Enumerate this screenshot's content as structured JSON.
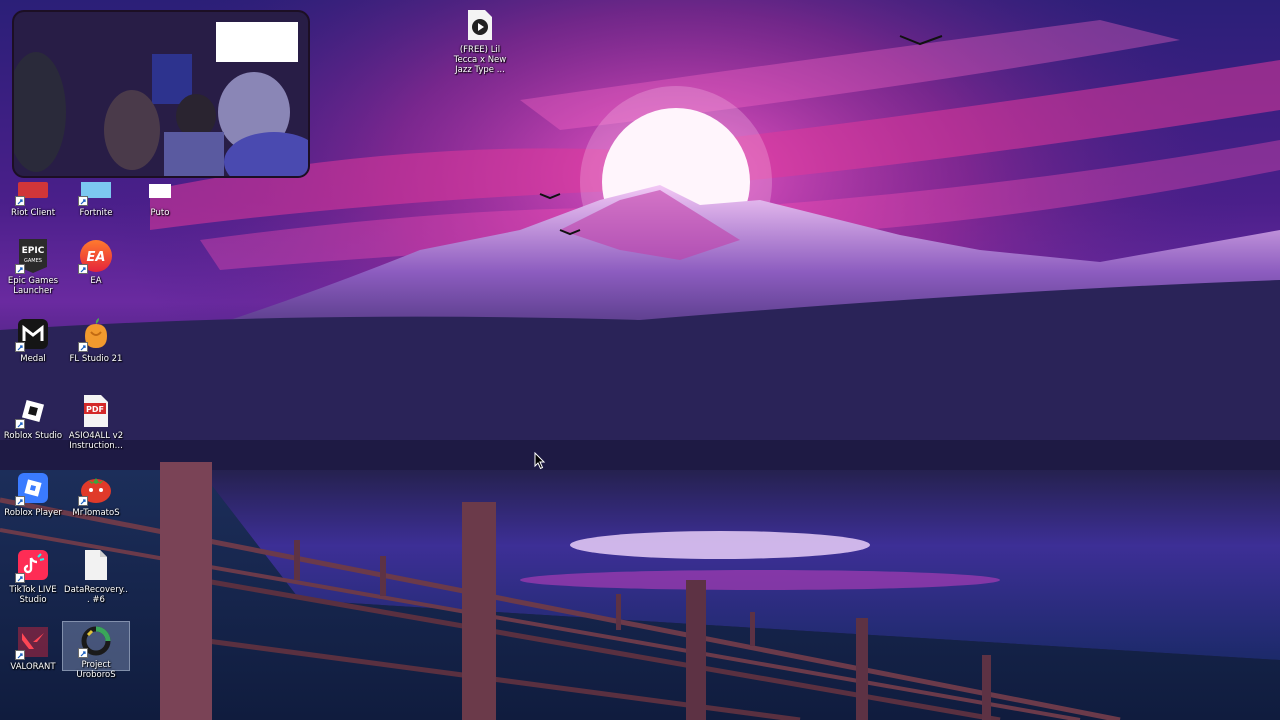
{
  "desktop": {
    "wallpaper": "synthwave-mountain-lake-sunset",
    "colors": {
      "sky_top": "#2a1a6e",
      "sky_magenta": "#e0389a",
      "sun": "#ffffff",
      "lake": "#3b2d8f",
      "fence": "#6b3a4a"
    }
  },
  "webcam_overlay": {
    "description_icon": "webcam-overlay"
  },
  "icons": [
    {
      "id": "riot-client",
      "label": "Riot Client",
      "icon": "riot-client-icon",
      "color": "#d13639"
    },
    {
      "id": "fortnite",
      "label": "Fortnite",
      "icon": "fortnite-icon",
      "color": "#7cc8f0"
    },
    {
      "id": "puto",
      "label": "Puto",
      "icon": "file-icon",
      "color": "#ffffff"
    },
    {
      "id": "epic-games",
      "label": "Epic Games Launcher",
      "icon": "epic-games-icon",
      "color": "#2a2a2a"
    },
    {
      "id": "ea",
      "label": "EA",
      "icon": "ea-icon",
      "color": "#ff4747"
    },
    {
      "id": "medal",
      "label": "Medal",
      "icon": "medal-icon",
      "color": "#1a1a1a"
    },
    {
      "id": "fl-studio",
      "label": "FL Studio 21",
      "icon": "fl-studio-icon",
      "color": "#f29a2e"
    },
    {
      "id": "roblox-studio",
      "label": "Roblox Studio",
      "icon": "roblox-studio-icon",
      "color": "#ffffff"
    },
    {
      "id": "asio4all",
      "label": "ASIO4ALL v2 Instruction...",
      "icon": "pdf-icon",
      "color": "#d42a2a",
      "badge": "PDF"
    },
    {
      "id": "roblox-player",
      "label": "Roblox Player",
      "icon": "roblox-player-icon",
      "color": "#3a7bff"
    },
    {
      "id": "mrtomatos",
      "label": "MrTomatoS",
      "icon": "tomato-icon",
      "color": "#e03a2a"
    },
    {
      "id": "tiktok-live",
      "label": "TikTok LIVE Studio",
      "icon": "tiktok-live-icon",
      "color": "#fe2c55"
    },
    {
      "id": "datarecovery",
      "label": "DataRecovery... #6",
      "icon": "blank-file-icon",
      "color": "#f2f2f2"
    },
    {
      "id": "valorant",
      "label": "VALORANT",
      "icon": "valorant-icon",
      "color": "#ff4655"
    },
    {
      "id": "project-uroboros",
      "label": "Project UroboroS",
      "icon": "uroboros-icon",
      "color": "#3aa65a"
    },
    {
      "id": "lil-tecca",
      "label": "(FREE) Lil Tecca x New Jazz Type ...",
      "icon": "media-file-icon",
      "color": "#222222"
    }
  ]
}
